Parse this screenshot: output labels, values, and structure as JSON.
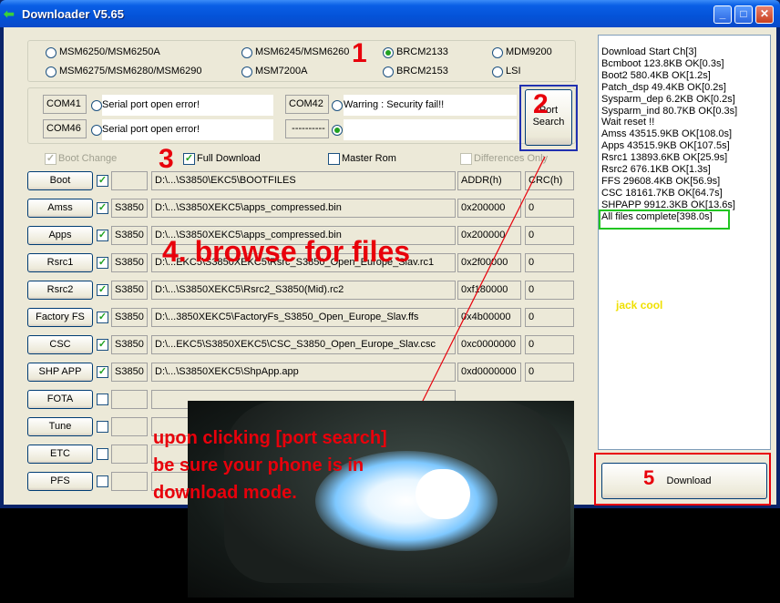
{
  "window": {
    "title": "Downloader V5.65",
    "min": "_",
    "max": "□",
    "close": "✕"
  },
  "chipsets": [
    {
      "label": "MSM6250/MSM6250A",
      "selected": false
    },
    {
      "label": "MSM6245/MSM6260",
      "selected": false
    },
    {
      "label": "BRCM2133",
      "selected": true
    },
    {
      "label": "MDM9200",
      "selected": false
    },
    {
      "label": "MSM6275/MSM6280/MSM6290",
      "selected": false
    },
    {
      "label": "MSM7200A",
      "selected": false
    },
    {
      "label": "BRCM2153",
      "selected": false
    },
    {
      "label": "LSI",
      "selected": false
    }
  ],
  "ports": [
    {
      "name": "COM41",
      "status": "Serial port open error!"
    },
    {
      "name": "COM42",
      "status": "Warring : Security fail!!"
    },
    {
      "name": "COM46",
      "status": "Serial port open error!"
    },
    {
      "name": "----------",
      "status": ""
    }
  ],
  "port_search": {
    "line1": "Port",
    "line2": "Search"
  },
  "options": {
    "boot_change": "Boot Change",
    "full_download": "Full Download",
    "master_rom": "Master Rom",
    "differences_only": "Differences Only"
  },
  "headers": {
    "addr": "ADDR(h)",
    "crc": "CRC(h)"
  },
  "files": [
    {
      "button": "Boot",
      "checked": true,
      "model": "",
      "path": "D:\\...\\S3850\\EKC5\\BOOTFILES",
      "addr": "",
      "crc": ""
    },
    {
      "button": "Amss",
      "checked": true,
      "model": "S3850",
      "path": "D:\\...\\S3850XEKC5\\apps_compressed.bin",
      "addr": "0x200000",
      "crc": "0"
    },
    {
      "button": "Apps",
      "checked": true,
      "model": "S3850",
      "path": "D:\\...\\S3850XEKC5\\apps_compressed.bin",
      "addr": "0x200000",
      "crc": "0"
    },
    {
      "button": "Rsrc1",
      "checked": true,
      "model": "S3850",
      "path": "D:\\...EKC5\\S3850XEKC5\\Rsrc_S3850_Open_Europe_Slav.rc1",
      "addr": "0x2f00000",
      "crc": "0"
    },
    {
      "button": "Rsrc2",
      "checked": true,
      "model": "S3850",
      "path": "D:\\...\\S3850XEKC5\\Rsrc2_S3850(Mid).rc2",
      "addr": "0xf180000",
      "crc": "0"
    },
    {
      "button": "Factory FS",
      "checked": true,
      "model": "S3850",
      "path": "D:\\...3850XEKC5\\FactoryFs_S3850_Open_Europe_Slav.ffs",
      "addr": "0x4b00000",
      "crc": "0"
    },
    {
      "button": "CSC",
      "checked": true,
      "model": "S3850",
      "path": "D:\\...EKC5\\S3850XEKC5\\CSC_S3850_Open_Europe_Slav.csc",
      "addr": "0xc0000000",
      "crc": "0"
    },
    {
      "button": "SHP APP",
      "checked": true,
      "model": "S3850",
      "path": "D:\\...\\S3850XEKC5\\ShpApp.app",
      "addr": "0xd0000000",
      "crc": "0"
    },
    {
      "button": "FOTA",
      "checked": false,
      "model": "",
      "path": "",
      "addr": "",
      "crc": ""
    },
    {
      "button": "Tune",
      "checked": false,
      "model": "",
      "path": "",
      "addr": "",
      "crc": ""
    },
    {
      "button": "ETC",
      "checked": false,
      "model": "",
      "path": "",
      "addr": "",
      "crc": ""
    },
    {
      "button": "PFS",
      "checked": false,
      "model": "",
      "path": "",
      "addr": "",
      "crc": ""
    }
  ],
  "log": [
    "Download Start Ch[3]",
    "Bcmboot 123.8KB OK[0.3s]",
    "Boot2 580.4KB OK[1.2s]",
    "Patch_dsp 49.4KB OK[0.2s]",
    "Sysparm_dep 6.2KB OK[0.2s]",
    "Sysparm_ind 80.7KB OK[0.3s]",
    "Wait reset !!",
    "Amss 43515.9KB OK[108.0s]",
    "Apps 43515.9KB OK[107.5s]",
    "Rsrc1 13893.6KB OK[25.9s]",
    "Rsrc2 676.1KB OK[1.3s]",
    "FFS 29608.4KB OK[56.9s]",
    "CSC 18161.7KB OK[64.7s]",
    "SHPAPP 9912.3KB OK[13.6s]",
    "All files complete[398.0s]"
  ],
  "download_button": "Download",
  "annotations": {
    "step1": "1",
    "step2": "2",
    "step3": "3",
    "step4": "4. browse for files",
    "step5": "5",
    "jack": "jack cool",
    "note1": "upon clicking [port search]",
    "note2": "be sure your phone is in",
    "note3": "download mode."
  },
  "colors": {
    "annotation_red": "#e8000b",
    "highlight_green": "#21c521",
    "jack_yellow": "#f0e000"
  }
}
